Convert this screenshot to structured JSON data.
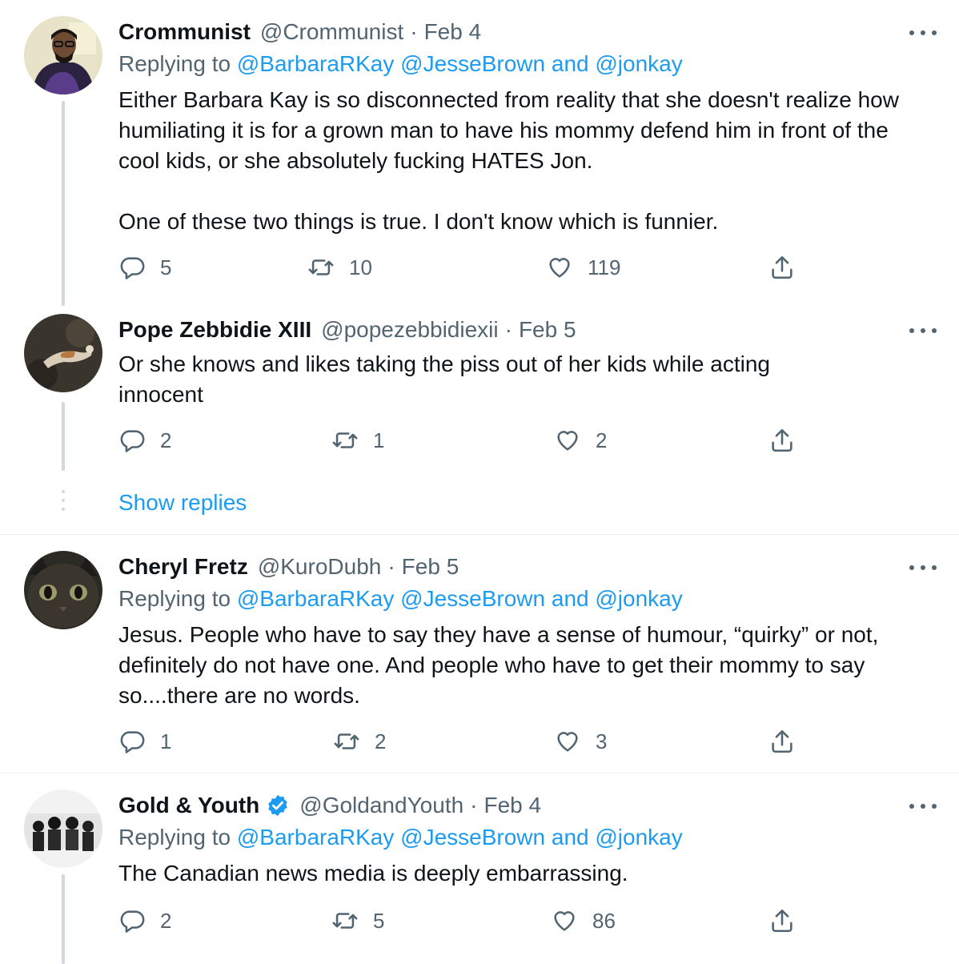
{
  "colors": {
    "link": "#1d9bf0",
    "muted": "#536471",
    "text": "#0f1419",
    "divider": "#eff3f4",
    "thread": "#cfd9de"
  },
  "tweets": [
    {
      "name": "Crommunist",
      "handle": "@Crommunist",
      "date": "Feb 4",
      "replying_prefix": "Replying to",
      "replying_to": "@BarbaraRKay @JesseBrown",
      "replying_and": "and",
      "replying_last": "@jonkay",
      "text_1": "Either Barbara Kay is so disconnected from reality that she doesn't realize how humiliating it is for a grown man to have his mommy defend him in front of the cool kids, or she absolutely fucking HATES Jon.",
      "text_2": "One of these two things is true. I don't know which is funnier.",
      "replies": "5",
      "retweets": "10",
      "likes": "119"
    },
    {
      "name": "Pope Zebbidie XIII",
      "handle": "@popezebbidiexii",
      "date": "Feb 5",
      "text_1": "Or she knows and likes taking the piss out of her kids while acting innocent",
      "replies": "2",
      "retweets": "1",
      "likes": "2"
    },
    {
      "name": "Cheryl Fretz",
      "handle": "@KuroDubh",
      "date": "Feb 5",
      "replying_prefix": "Replying to",
      "replying_to": "@BarbaraRKay @JesseBrown",
      "replying_and": "and",
      "replying_last": "@jonkay",
      "text_1": "Jesus. People who have to say they have a sense of humour, “quirky” or not, definitely do not have one. And people who have to get their mommy to say so....there are no words.",
      "replies": "1",
      "retweets": "2",
      "likes": "3"
    },
    {
      "name": "Gold & Youth",
      "handle": "@GoldandYouth",
      "date": "Feb 4",
      "verified": true,
      "replying_prefix": "Replying to",
      "replying_to": "@BarbaraRKay @JesseBrown",
      "replying_and": "and",
      "replying_last": "@jonkay",
      "text_1": "The Canadian news media is deeply embarrassing.",
      "replies": "2",
      "retweets": "5",
      "likes": "86"
    }
  ],
  "show_replies": "Show replies",
  "icons": {
    "reply": "reply-icon",
    "retweet": "retweet-icon",
    "like": "heart-icon",
    "share": "share-icon",
    "more": "more-icon",
    "verified": "verified-badge-icon"
  }
}
